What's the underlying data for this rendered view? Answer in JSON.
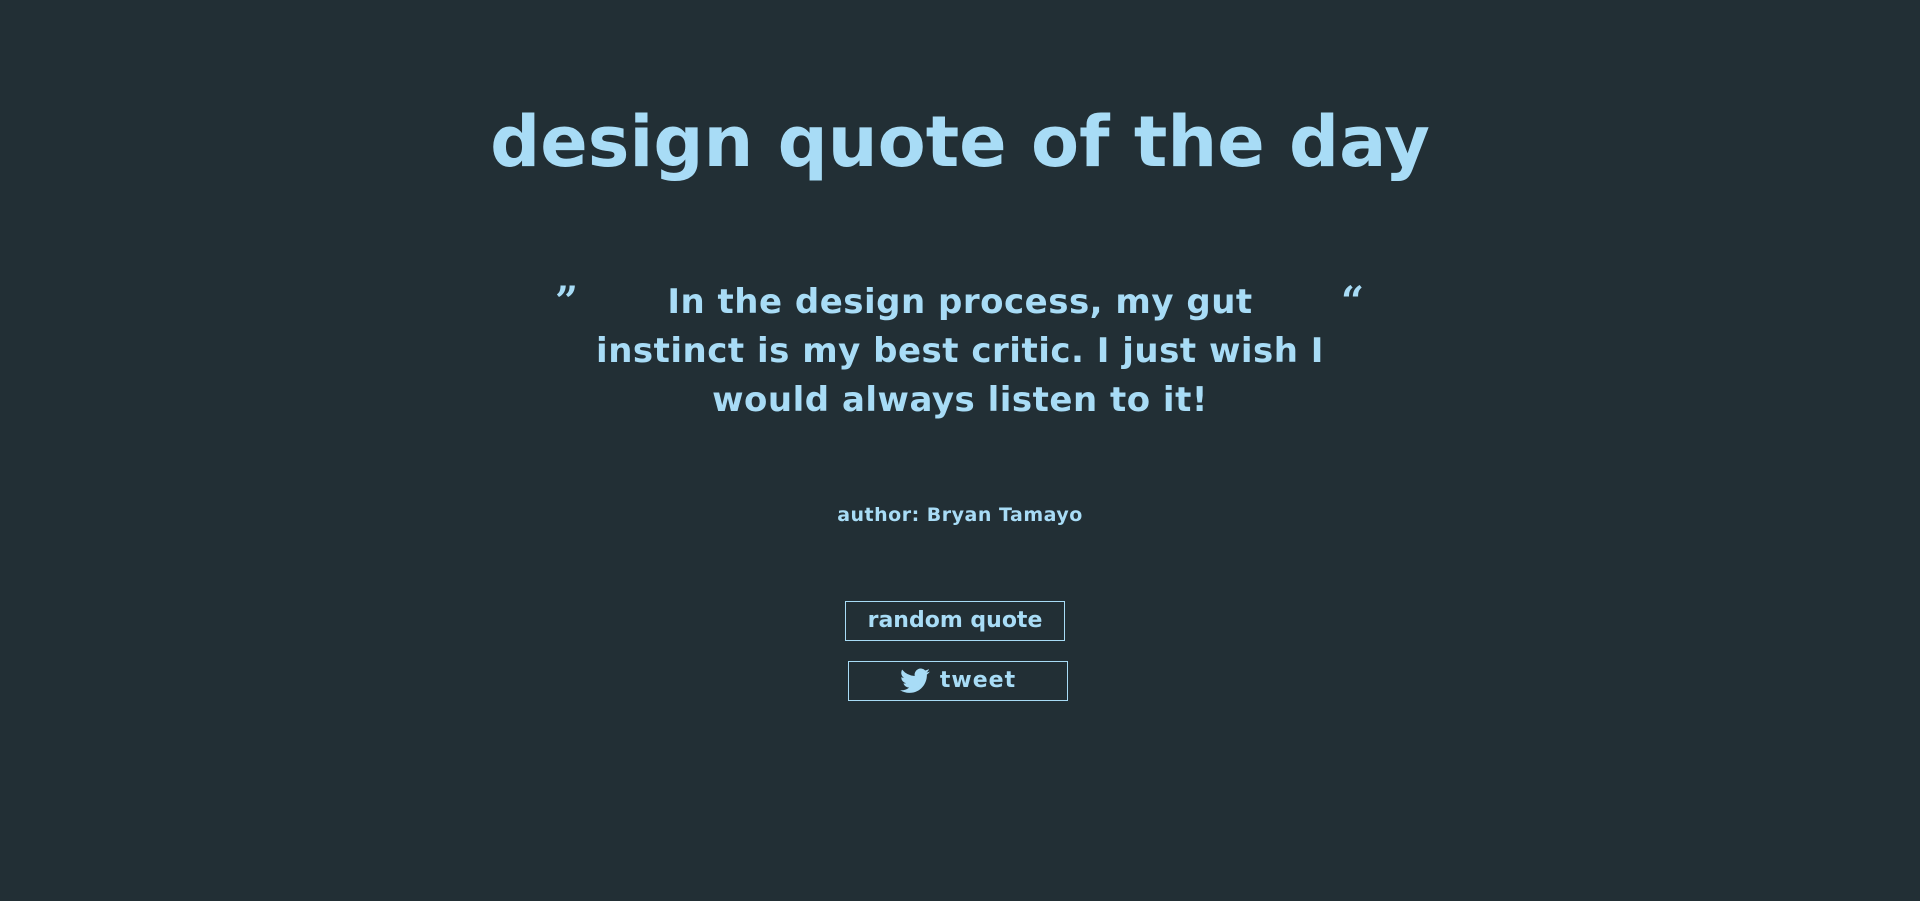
{
  "header": {
    "title": "design quote of the day"
  },
  "quote": {
    "open_mark": "”",
    "close_mark": "“",
    "text": "In the design process, my gut instinct is my best critic. I just wish I would always listen to it!",
    "author": "author: Bryan Tamayo"
  },
  "actions": {
    "random_label": "random quote",
    "tweet_label": "tweet",
    "tweet_icon": "twitter-bird-icon"
  },
  "colors": {
    "background": "#222f35",
    "accent": "#a8dcf6"
  }
}
